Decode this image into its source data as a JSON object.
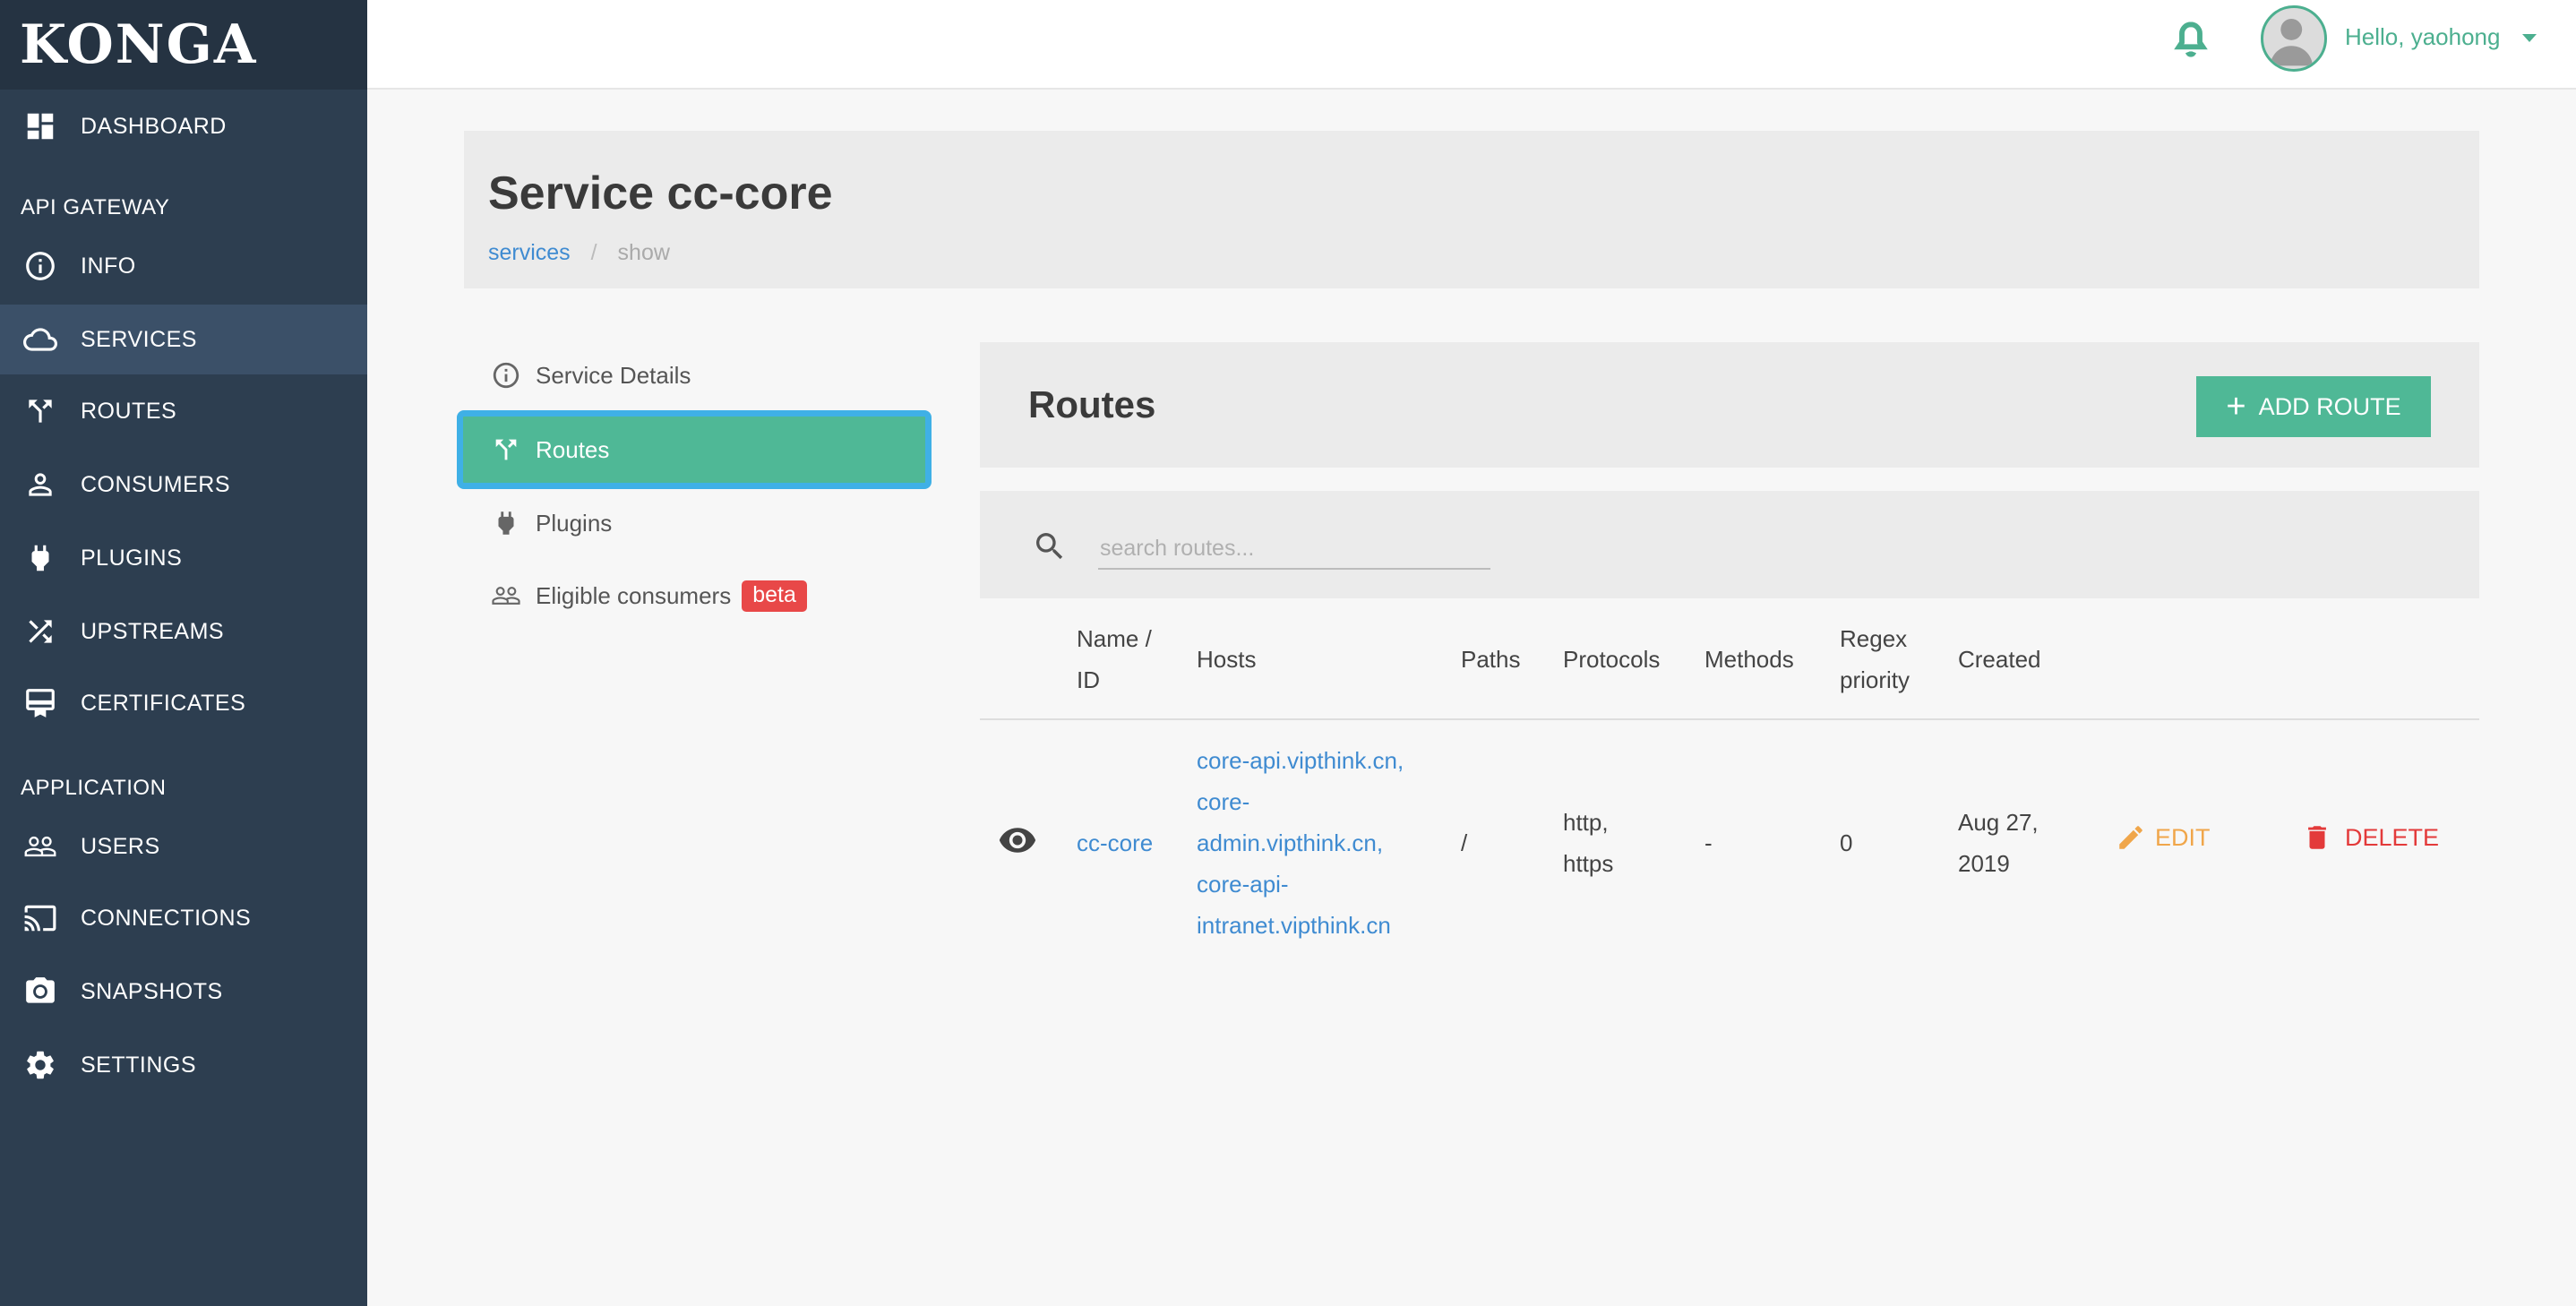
{
  "brand": "KONGA",
  "sidebar": {
    "items": [
      {
        "label": "DASHBOARD",
        "icon": "dashboard-icon"
      },
      {
        "label": "INFO",
        "icon": "info-icon"
      },
      {
        "label": "SERVICES",
        "icon": "cloud-icon"
      },
      {
        "label": "ROUTES",
        "icon": "routes-icon"
      },
      {
        "label": "CONSUMERS",
        "icon": "person-icon"
      },
      {
        "label": "PLUGINS",
        "icon": "plug-icon"
      },
      {
        "label": "UPSTREAMS",
        "icon": "shuffle-icon"
      },
      {
        "label": "CERTIFICATES",
        "icon": "certificate-icon"
      },
      {
        "label": "USERS",
        "icon": "people-icon"
      },
      {
        "label": "CONNECTIONS",
        "icon": "cast-icon"
      },
      {
        "label": "SNAPSHOTS",
        "icon": "camera-icon"
      },
      {
        "label": "SETTINGS",
        "icon": "gear-icon"
      }
    ],
    "section_api": "API GATEWAY",
    "section_app": "APPLICATION",
    "active": "SERVICES"
  },
  "topbar": {
    "greeting": "Hello, yaohong"
  },
  "header": {
    "title": "Service cc-core",
    "breadcrumb": {
      "link": "services",
      "separator": "/",
      "current": "show"
    }
  },
  "submenu": {
    "items": [
      {
        "label": "Service Details",
        "icon": "info-icon"
      },
      {
        "label": "Routes",
        "icon": "routes-icon"
      },
      {
        "label": "Plugins",
        "icon": "plug-icon"
      },
      {
        "label": "Eligible consumers",
        "icon": "people-icon"
      }
    ],
    "badge": "beta",
    "active": "Routes"
  },
  "routes": {
    "title": "Routes",
    "add_label": "ADD ROUTE",
    "search_placeholder": "search routes...",
    "columns": [
      "Name /",
      "ID",
      "Hosts",
      "Paths",
      "Protocols",
      "Methods",
      "Regex",
      "priority",
      "Created"
    ],
    "rows": [
      {
        "name": "cc-core",
        "hosts": [
          "core-api.vipthink.cn,",
          "core-",
          "admin.vipthink.cn,",
          "core-api-",
          "intranet.vipthink.cn"
        ],
        "paths": "/",
        "protocols": [
          "http,",
          "https"
        ],
        "methods": "-",
        "regex_priority": "0",
        "created": [
          "Aug 27,",
          "2019"
        ],
        "edit_label": "EDIT",
        "delete_label": "DELETE"
      }
    ]
  },
  "colors": {
    "sidebar_bg": "#2d3e50",
    "brand_bg": "#253342",
    "accent_green": "#4fb896",
    "link_blue": "#3f8bd1",
    "edit_orange": "#f0a64a",
    "delete_red": "#e33a3a",
    "focus_ring": "#3fb0e6"
  }
}
